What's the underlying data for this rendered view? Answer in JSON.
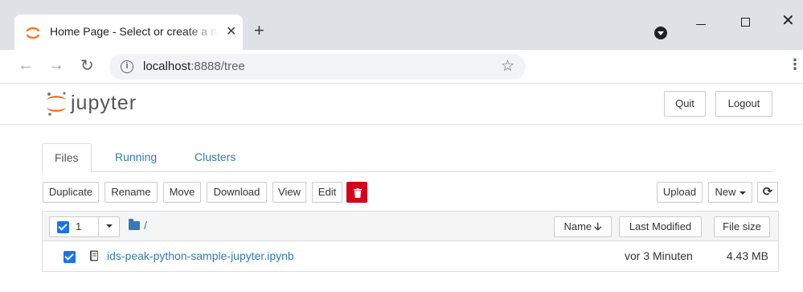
{
  "browser": {
    "tab_title": "Home Page - Select or create a notebook",
    "tab_close": "✕",
    "new_tab": "+",
    "url_host": "localhost",
    "url_rest": ":8888/tree",
    "back": "←",
    "forward": "→",
    "reload": "↻",
    "star": "☆",
    "menu": "⋮",
    "win_close": "✕",
    "colors": {
      "frame": "#dee1e6",
      "omnibox": "#f1f3f4",
      "favicon": "#f37726"
    }
  },
  "header": {
    "logo_text": "jupyter",
    "quit_label": "Quit",
    "logout_label": "Logout"
  },
  "tabs": [
    {
      "label": "Files",
      "active": true
    },
    {
      "label": "Running",
      "active": false
    },
    {
      "label": "Clusters",
      "active": false
    }
  ],
  "actions": {
    "duplicate": "Duplicate",
    "rename": "Rename",
    "move": "Move",
    "download": "Download",
    "view": "View",
    "edit": "Edit",
    "delete_icon": "trash-icon",
    "upload": "Upload",
    "new": "New",
    "refresh": "⟳",
    "delete_color": "#d9001b"
  },
  "list": {
    "selected_count": "1",
    "path": "/",
    "columns": {
      "name": "Name",
      "name_sort": "🡣",
      "last_modified": "Last Modified",
      "file_size": "File size"
    },
    "rows": [
      {
        "name": "ids-peak-python-sample-jupyter.ipynb",
        "modified": "vor 3 Minuten",
        "size": "4.43 MB",
        "checked": true
      }
    ],
    "link_color": "#337ab7",
    "checkbox_color": "#1a73e8"
  }
}
